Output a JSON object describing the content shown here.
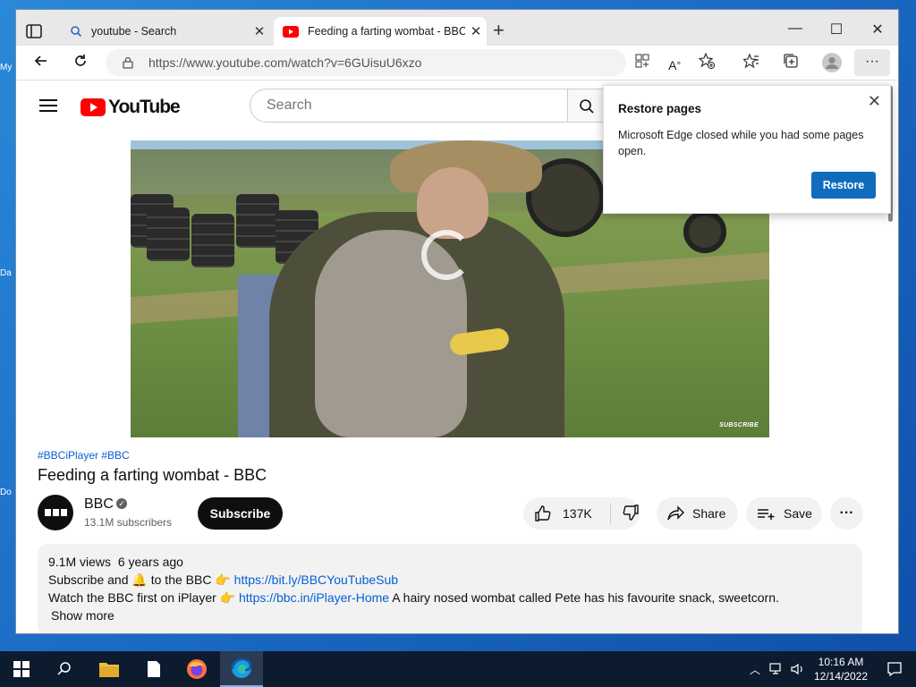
{
  "desktop": {
    "icon_labels": [
      "My",
      "Da",
      "Do"
    ]
  },
  "browser": {
    "tabs": [
      {
        "title": "youtube - Search",
        "icon": "search-icon",
        "active": false
      },
      {
        "title": "Feeding a farting wombat - BBC",
        "icon": "youtube-icon",
        "active": true
      }
    ],
    "address": {
      "url": "https://www.youtube.com/watch?v=6GUisuU6xzo"
    },
    "window_controls": {
      "minimize": "—",
      "maximize": "☐",
      "close": "✕"
    }
  },
  "youtube": {
    "logo_text": "YouTube",
    "search": {
      "placeholder": "Search"
    },
    "video": {
      "watermark": "SUBSCRIBE"
    },
    "hashtags": "#BBCiPlayer #BBC",
    "title": "Feeding a farting wombat - BBC",
    "channel": {
      "name": "BBC",
      "subscribers": "13.1M subscribers"
    },
    "subscribe_label": "Subscribe",
    "actions": {
      "likes": "137K",
      "share": "Share",
      "save": "Save"
    },
    "description": {
      "views": "9.1M views",
      "age": "6 years ago",
      "line1_prefix": "Subscribe and",
      "line1_mid": "to the BBC",
      "line1_link": "https://bit.ly/BBCYouTubeSub",
      "line2_prefix": "Watch the BBC first on iPlayer",
      "line2_link": "https://bbc.in/iPlayer-Home",
      "line2_suffix": "A hairy nosed wombat called Pete has his favourite snack, sweetcorn.",
      "show_more": "Show more"
    }
  },
  "popup": {
    "title": "Restore pages",
    "body": "Microsoft Edge closed while you had some pages open.",
    "button": "Restore"
  },
  "taskbar": {
    "time": "10:16 AM",
    "date": "12/14/2022"
  },
  "colors": {
    "accent": "#0f6cbd",
    "youtube_red": "#ff0000",
    "link": "#065fd4"
  }
}
